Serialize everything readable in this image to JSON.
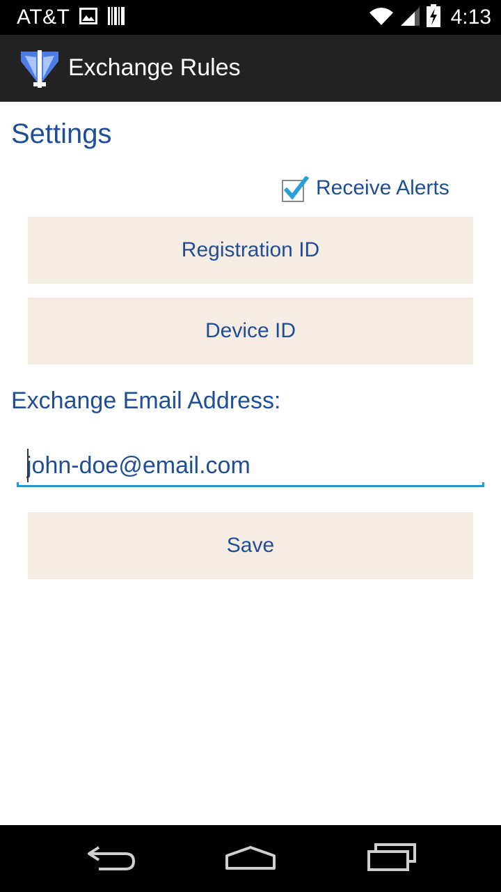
{
  "status_bar": {
    "carrier": "AT&T",
    "time": "4:13",
    "icons": [
      "image-icon",
      "barcode-icon",
      "wifi-icon",
      "signal-icon",
      "battery-charging-icon"
    ]
  },
  "action_bar": {
    "title": "Exchange Rules",
    "logo_icon": "app-logo-icon"
  },
  "settings": {
    "title": "Settings",
    "receive_alerts": {
      "label": "Receive Alerts",
      "checked": true
    },
    "registration_button": "Registration ID",
    "device_button": "Device ID",
    "email_label": "Exchange Email Address:",
    "email_value": "john-doe@email.com",
    "save_button": "Save"
  },
  "nav_bar": {
    "icons": [
      "back-icon",
      "home-icon",
      "recents-icon"
    ]
  },
  "colors": {
    "text_blue": "#1f4e96",
    "button_bg": "#f5ece3",
    "action_bar_bg": "#222222",
    "input_underline": "#1e9bd6",
    "checkbox_check": "#2a9fd8"
  }
}
